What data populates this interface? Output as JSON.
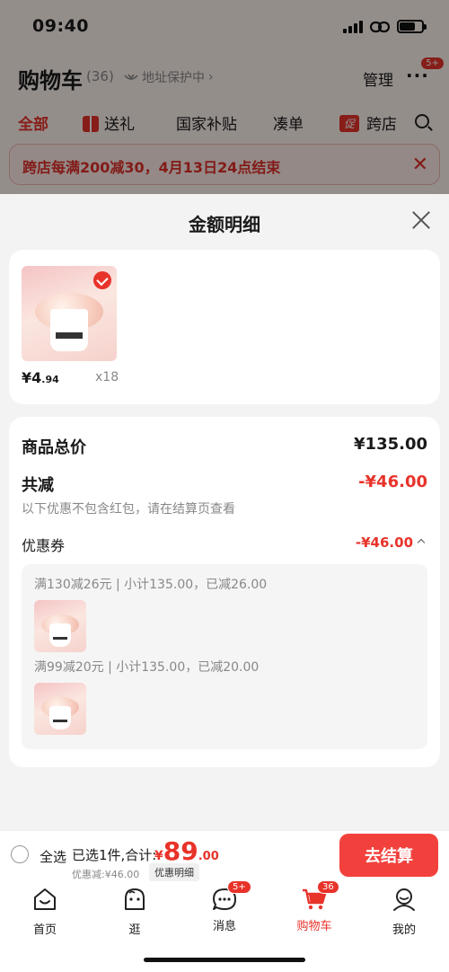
{
  "status_bar": {
    "time": "09:40"
  },
  "header": {
    "title": "购物车",
    "count": "(36)",
    "address_protect": "地址保护中",
    "manage": "管理",
    "more_badge": "5+"
  },
  "filter_tabs": [
    "全部",
    "送礼",
    "国家补贴",
    "凑单",
    "跨店"
  ],
  "promo_tag": "促",
  "promo_banner": {
    "text": "跨店每满200减30，4月13日24点结束"
  },
  "sheet": {
    "title": "金额明细",
    "product": {
      "price_main": "¥4",
      "price_dec": ".94",
      "qty": "x18"
    },
    "total_label": "商品总价",
    "total_value": "¥135.00",
    "reduce_label": "共减",
    "reduce_value": "-¥46.00",
    "note": "以下优惠不包含红包，请在结算页查看",
    "coupon_label": "优惠券",
    "coupon_value": "-¥46.00",
    "coupon_rules": [
      "满130减26元 | 小计135.00，已减26.00",
      "满99减20元 | 小计135.00，已减20.00"
    ]
  },
  "checkout": {
    "select_all": "全选",
    "selected_text": "已选1件,合计:",
    "yen": "¥",
    "total_int": "89",
    "total_dec": ".00",
    "discount_text": "优惠减:¥46.00",
    "detail_link": "优惠明细",
    "button": "去结算"
  },
  "tab_bar": [
    {
      "label": "首页",
      "icon": "home-icon"
    },
    {
      "label": "逛",
      "icon": "explore-icon"
    },
    {
      "label": "消息",
      "icon": "message-icon",
      "badge": "5+"
    },
    {
      "label": "购物车",
      "icon": "cart-icon",
      "badge": "36",
      "active": true
    },
    {
      "label": "我的",
      "icon": "profile-icon"
    }
  ],
  "colors": {
    "accent": "#e8332a",
    "sheet_bg": "#f3f3f3"
  }
}
